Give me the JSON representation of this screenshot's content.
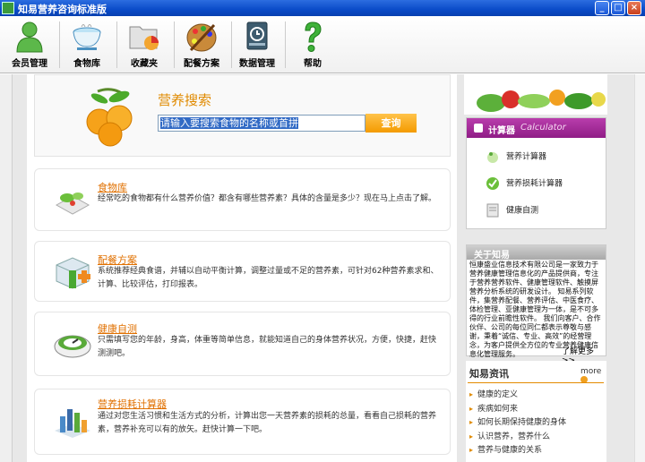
{
  "window": {
    "title": "知易营养咨询标准版"
  },
  "toolbar": {
    "items": [
      {
        "label": "会员管理",
        "icon": "member-icon"
      },
      {
        "label": "食物库",
        "icon": "food-bowl-icon"
      },
      {
        "label": "收藏夹",
        "icon": "folder-chart-icon"
      },
      {
        "label": "配餐方案",
        "icon": "palette-icon"
      },
      {
        "label": "数据管理",
        "icon": "database-icon"
      },
      {
        "label": "帮助",
        "icon": "help-icon"
      }
    ]
  },
  "search": {
    "title": "营养搜索",
    "input_value": "请输入要搜索食物的名称或首拼",
    "button_label": "查询"
  },
  "cards": [
    {
      "title": "食物库",
      "text": "经常吃的食物都有什么营养价值？都含有哪些营养素？具体的含量是多少？现在马上点击了解。"
    },
    {
      "title": "配餐方案",
      "text": "系统推荐经典食谱，并辅以自动平衡计算，调整过量或不足的营养素，可针对62种营养素求和、计算、比较评估，打印报表。"
    },
    {
      "title": "健康自测",
      "text": "只需填写您的年龄，身高，体重等简单信息，就能知道自己的身体营养状况，方便，快捷，赶快测测吧。"
    },
    {
      "title": "营养损耗计算器",
      "text": "通过对您生活习惯和生活方式的分析，计算出您一天营养素的损耗的总量，看看自己损耗的营养素，营养补充可以有的放矢。赶快计算一下吧。"
    }
  ],
  "calculator": {
    "title": "计算器",
    "subtitle": "Calculator",
    "items": [
      "营养计算器",
      "营养损耗计算器",
      "健康自测"
    ]
  },
  "about": {
    "title": "关于知易",
    "text": "恒康盛业信息技术有限公司是一家致力于营养健康管理信息化的产品提供商，专注于营养营养软件、健康管理软件、触摸屏营养分析系统的研发设计。 知易系列软件，集营养配餐、营养评估、中医食疗、体检管理、亚健康管理为一体，是不可多得的行业前瞻性软件。 我们向客户、合作伙伴、公司的每位同仁都表示尊敬与感谢，秉着“诚信、专业、高效”的经营理念，为客户提供全方位的专业营养健康信息化管理服务。",
    "more": "了解更多>>"
  },
  "news": {
    "title": "知易资讯",
    "more": "more",
    "items": [
      "健康的定义",
      "疾病如何来",
      "如何长期保持健康的身体",
      "认识营养，营养什么",
      "营养与健康的关系"
    ]
  }
}
